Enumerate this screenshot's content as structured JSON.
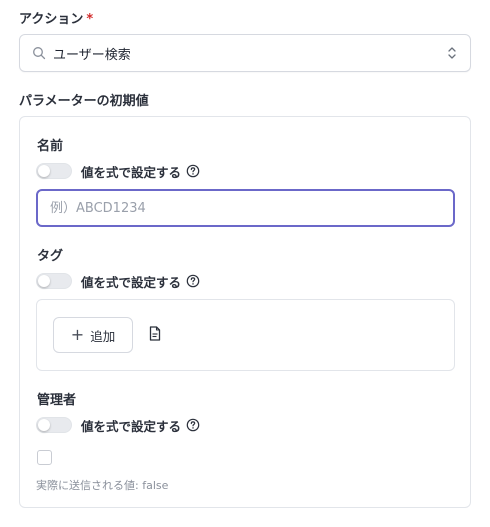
{
  "action": {
    "label": "アクション",
    "required_mark": "*",
    "selected_value": "ユーザー検索"
  },
  "params": {
    "section_title": "パラメーターの初期値",
    "name_field": {
      "title": "名前",
      "toggle_label": "値を式で設定する",
      "placeholder": "例）ABCD1234"
    },
    "tag_field": {
      "title": "タグ",
      "toggle_label": "値を式で設定する",
      "add_button_label": "追加"
    },
    "admin_field": {
      "title": "管理者",
      "toggle_label": "値を式で設定する",
      "hint": "実際に送信される値: false"
    }
  },
  "colors": {
    "required": "#d22b2b",
    "focus_border": "#6b68c9"
  },
  "icons": {
    "search": "search-icon",
    "select_chevron": "chevron-up-down-icon",
    "help": "question-circle-icon",
    "add": "plus-icon",
    "document": "document-icon"
  }
}
